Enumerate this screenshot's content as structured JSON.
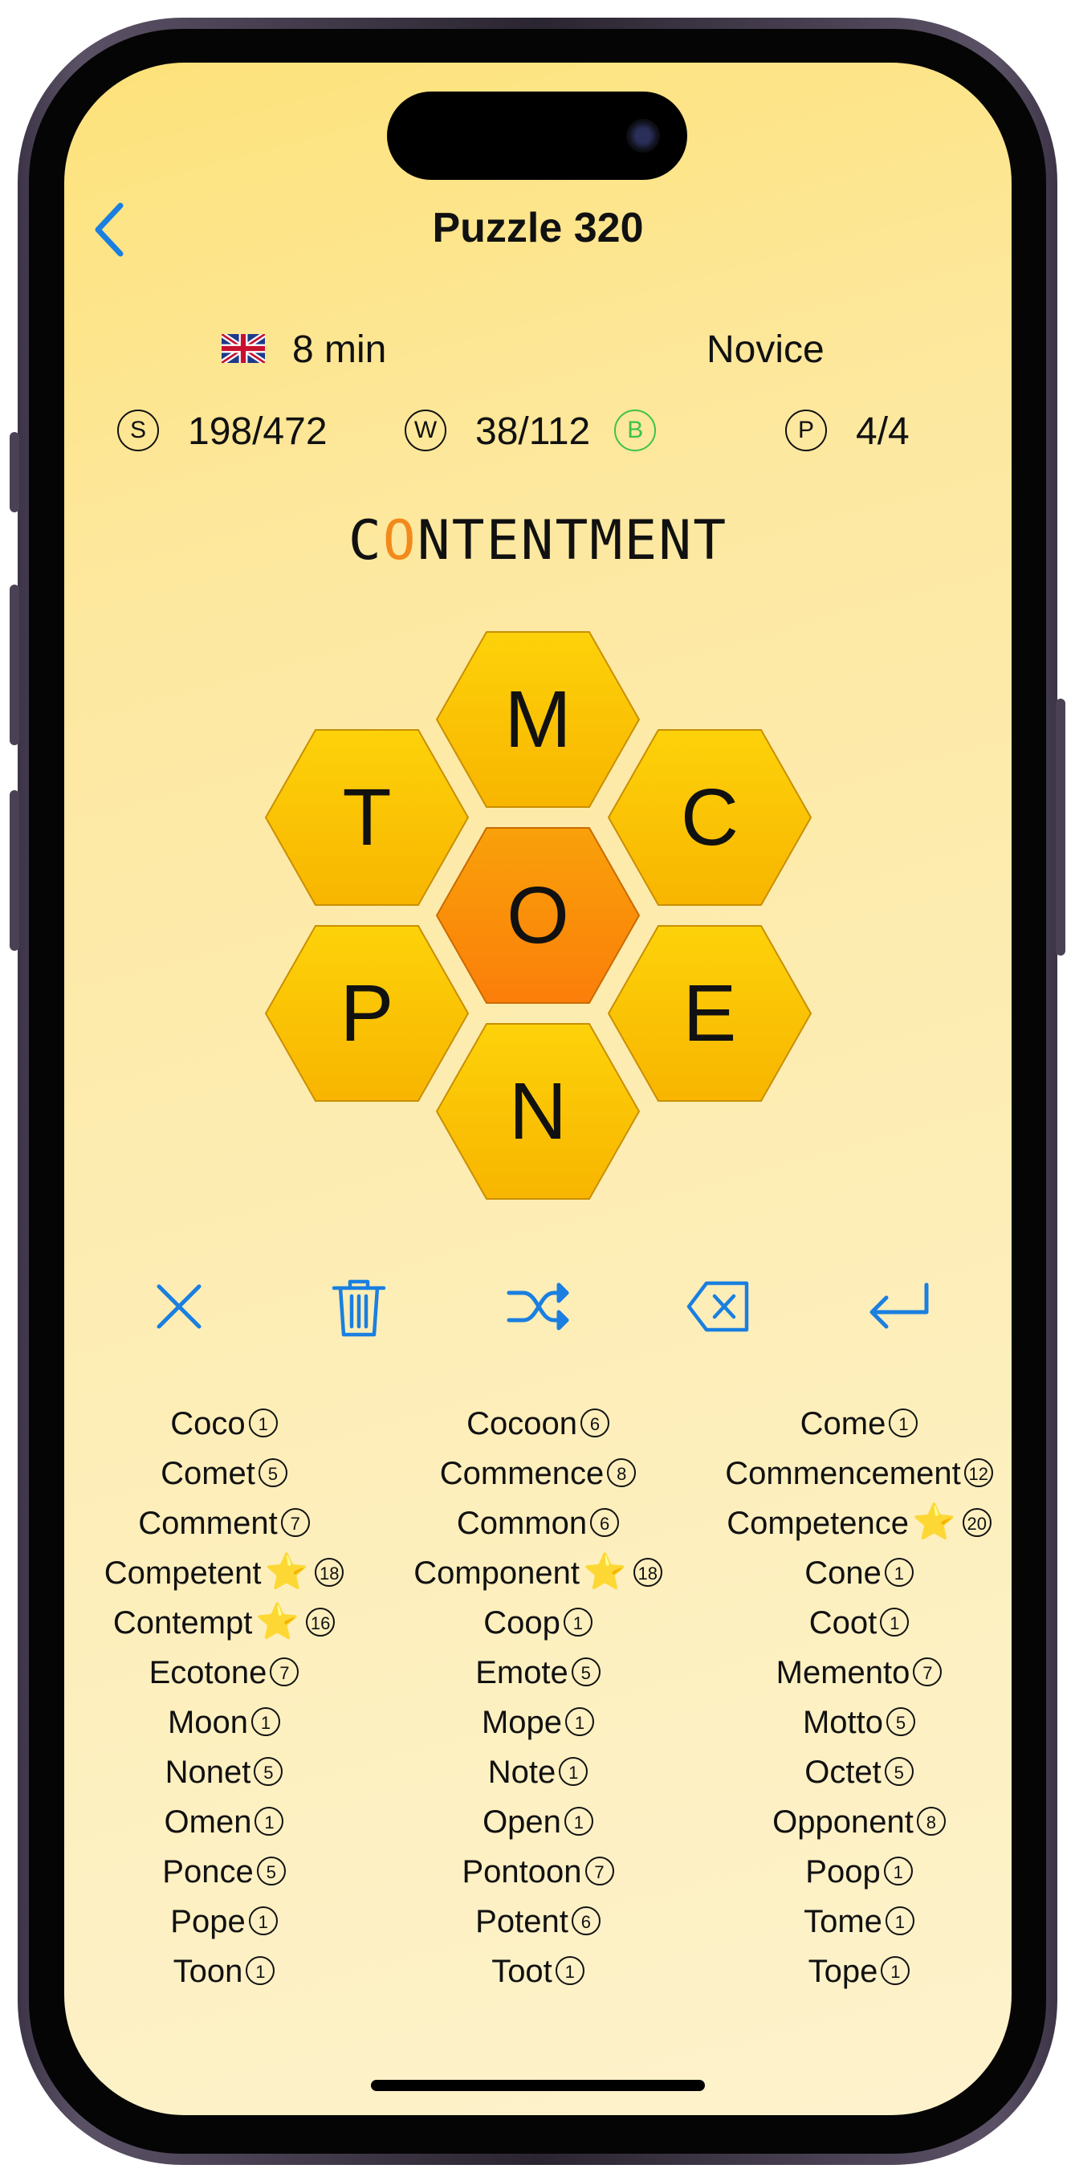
{
  "header": {
    "title": "Puzzle 320",
    "back_icon": "chevron-left-icon"
  },
  "info": {
    "time": "8 min",
    "level": "Novice",
    "flag_icon": "uk-flag-icon",
    "score_badge": "S",
    "score": "198/472",
    "words_badge": "W",
    "words": "38/112",
    "bonus_badge": "B",
    "pangram_badge": "P",
    "pangrams": "4/4"
  },
  "current_word": {
    "prefix": "C",
    "highlight": "O",
    "rest": "NTENTMENT"
  },
  "hive": {
    "center": "O",
    "top": "M",
    "top_left": "T",
    "top_right": "C",
    "bottom_left": "P",
    "bottom_right": "E",
    "bottom": "N"
  },
  "actions": [
    "close-icon",
    "trash-icon",
    "shuffle-icon",
    "backspace-icon",
    "enter-icon"
  ],
  "colors": {
    "accent": "#1a7fe0",
    "hex_yellow": "#fbc300",
    "hex_orange": "#f98a0e",
    "bonus_green": "#3cc24b"
  },
  "found_words": {
    "col1": [
      {
        "w": "Coco",
        "n": "1"
      },
      {
        "w": "Comet",
        "n": "5"
      },
      {
        "w": "Comment",
        "n": "7"
      },
      {
        "w": "Competent",
        "n": "18",
        "star": "⭐"
      },
      {
        "w": "Contempt",
        "n": "16",
        "star": "⭐"
      },
      {
        "w": "Ecotone",
        "n": "7"
      },
      {
        "w": "Moon",
        "n": "1"
      },
      {
        "w": "Nonet",
        "n": "5"
      },
      {
        "w": "Omen",
        "n": "1"
      },
      {
        "w": "Ponce",
        "n": "5"
      },
      {
        "w": "Pope",
        "n": "1"
      },
      {
        "w": "Toon",
        "n": "1"
      }
    ],
    "col2": [
      {
        "w": "Cocoon",
        "n": "6"
      },
      {
        "w": "Commence",
        "n": "8"
      },
      {
        "w": "Common",
        "n": "6"
      },
      {
        "w": "Component",
        "n": "18",
        "star": "⭐"
      },
      {
        "w": "Coop",
        "n": "1"
      },
      {
        "w": "Emote",
        "n": "5"
      },
      {
        "w": "Mope",
        "n": "1"
      },
      {
        "w": "Note",
        "n": "1"
      },
      {
        "w": "Open",
        "n": "1"
      },
      {
        "w": "Pontoon",
        "n": "7"
      },
      {
        "w": "Potent",
        "n": "6"
      },
      {
        "w": "Toot",
        "n": "1"
      }
    ],
    "col3": [
      {
        "w": "Come",
        "n": "1"
      },
      {
        "w": "Commencement",
        "n": "12"
      },
      {
        "w": "Competence",
        "n": "20",
        "star": "⭐"
      },
      {
        "w": "Cone",
        "n": "1"
      },
      {
        "w": "Coot",
        "n": "1"
      },
      {
        "w": "Memento",
        "n": "7"
      },
      {
        "w": "Motto",
        "n": "5"
      },
      {
        "w": "Octet",
        "n": "5"
      },
      {
        "w": "Opponent",
        "n": "8"
      },
      {
        "w": "Poop",
        "n": "1"
      },
      {
        "w": "Tome",
        "n": "1"
      },
      {
        "w": "Tope",
        "n": "1"
      }
    ]
  }
}
